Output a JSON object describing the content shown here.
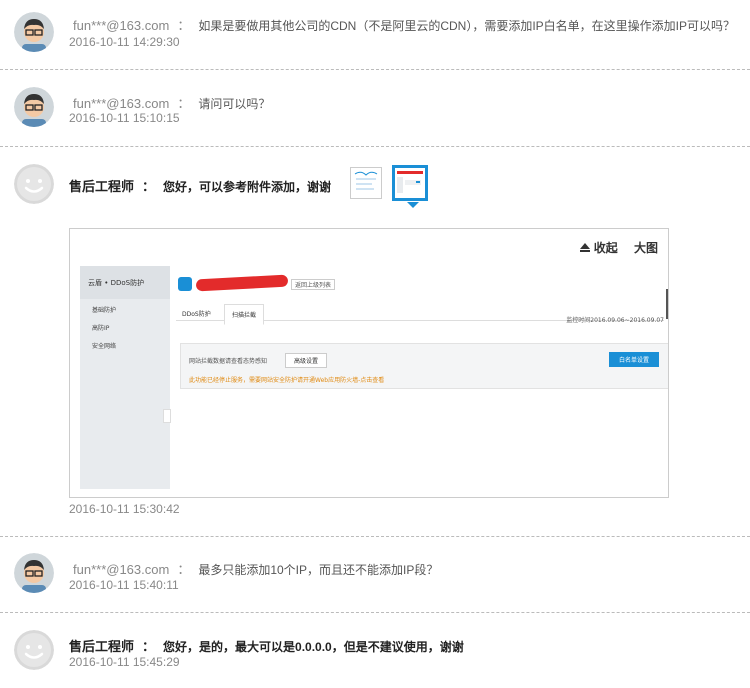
{
  "messages": [
    {
      "user": "fun***@163.com",
      "text": "如果是要做用其他公司的CDN（不是阿里云的CDN），需要添加IP白名单，在这里操作添加IP可以吗？",
      "time": "2016-10-11 14:29:30"
    },
    {
      "user": "fun***@163.com",
      "text": "请问可以吗？",
      "time": "2016-10-11 15:10:15"
    },
    {
      "user": "售后工程师",
      "text": "您好，可以参考附件添加，谢谢",
      "time": "2016-10-11 15:30:42"
    },
    {
      "user": "fun***@163.com",
      "text": "最多只能添加10个IP，而且还不能添加IP段？",
      "time": "2016-10-11 15:40:11"
    },
    {
      "user": "售后工程师",
      "text": "您好，是的，最大可以是0.0.0.0，但是不建议使用，谢谢",
      "time": "2016-10-11 15:45:29"
    }
  ],
  "colon": "：",
  "viewer": {
    "collapse_label": "收起",
    "fullsize_label": "大图"
  },
  "attachment": {
    "sidebar_title": "云盾 • DDoS防护",
    "sidebar_items": [
      "基础防护",
      "高防IP",
      "安全网络"
    ],
    "back_label": "返回上级列表",
    "tabs": [
      "DDoS防护",
      "扫描拦截"
    ],
    "monitor_range": "监控时间2016.09.06~2016.09.07",
    "notice": "网站拦截数据请查看态势感知",
    "advanced_button": "高级设置",
    "whitelist_button": "白名单设置",
    "warning": "此功能已经停止服务，需要网站安全防护请开通Web应用防火墙-点击查看"
  },
  "colors": {
    "accent": "#1a8fd6",
    "divider": "#bbbbbb",
    "redaction": "#e32b2b"
  }
}
